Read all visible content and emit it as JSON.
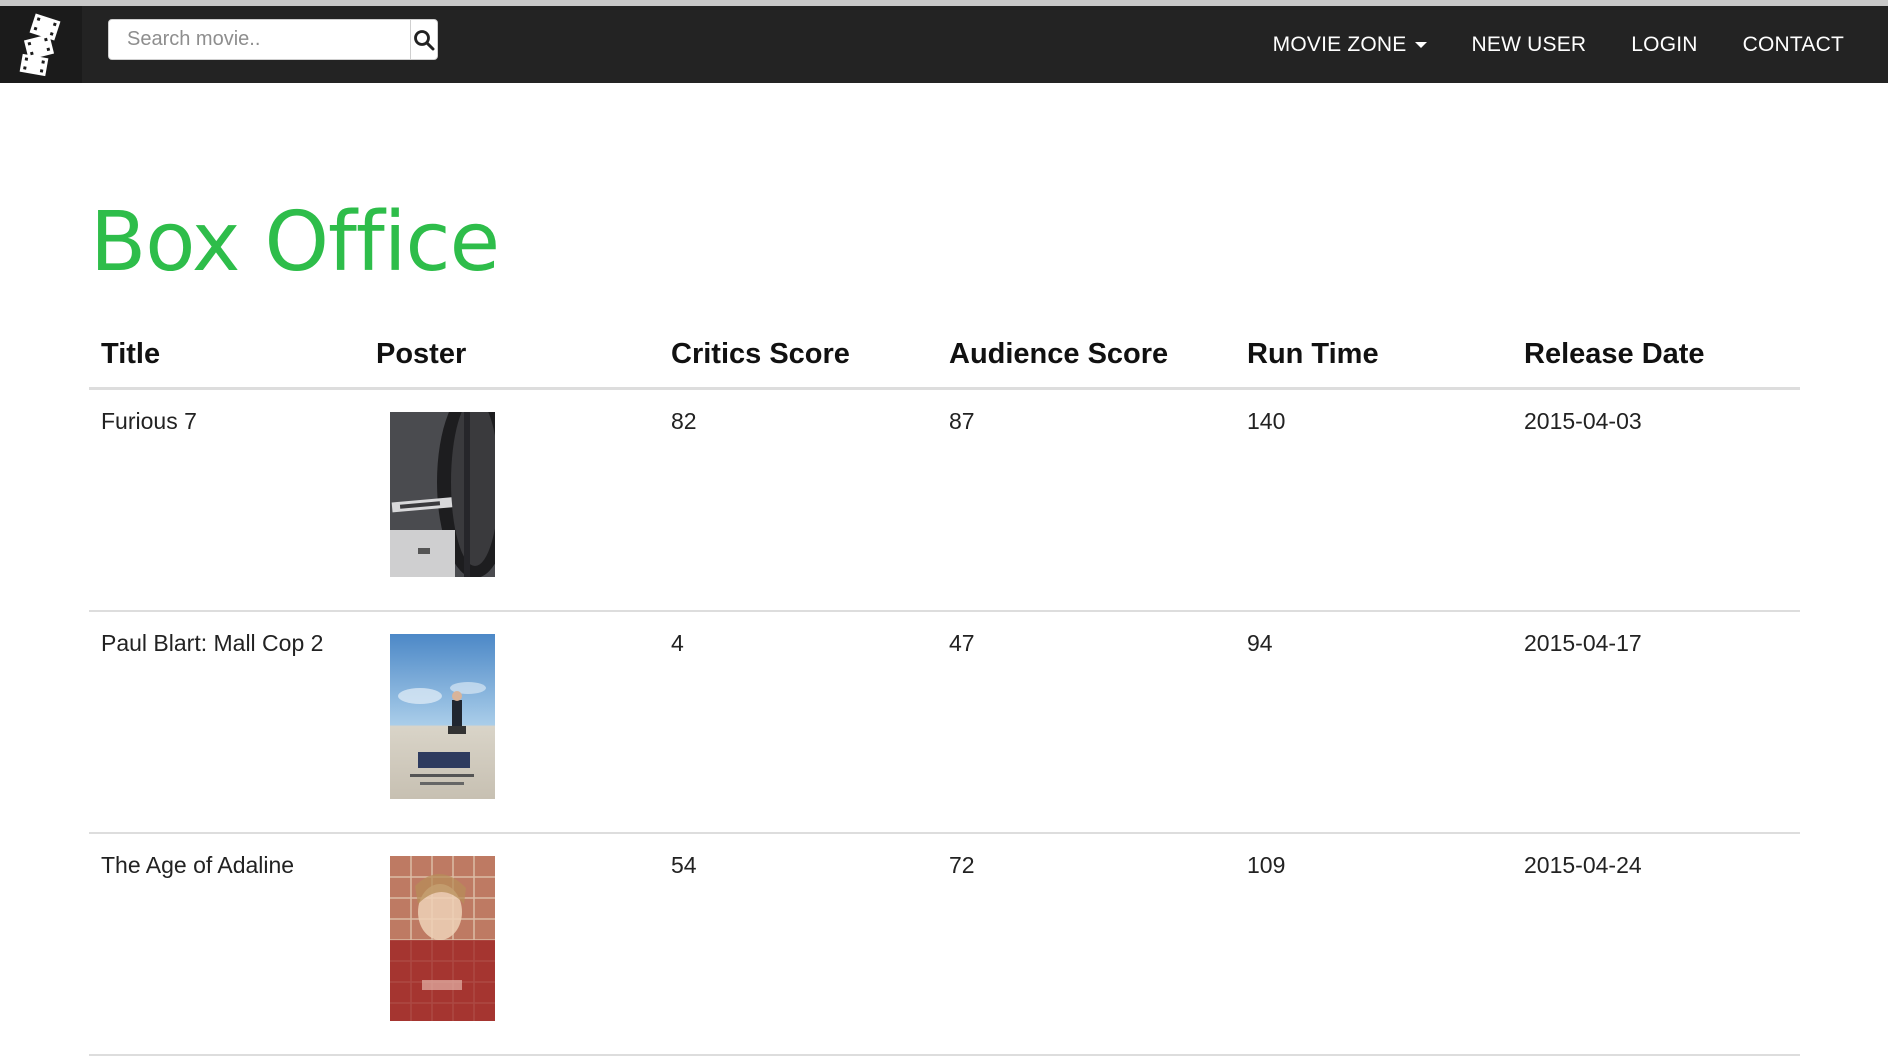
{
  "navbar": {
    "logo_icon": "film-reel-icon",
    "search": {
      "placeholder": "Search movie..",
      "value": "",
      "button_icon": "search-icon"
    },
    "links": {
      "movie_zone": "MOVIE ZONE",
      "new_user": "NEW USER",
      "login": "LOGIN",
      "contact": "CONTACT"
    }
  },
  "page": {
    "title": "Box Office"
  },
  "table": {
    "headers": [
      "Title",
      "Poster",
      "Critics Score",
      "Audience Score",
      "Run Time",
      "Release Date"
    ],
    "rows": [
      {
        "title": "Furious 7",
        "poster": "furious-7-poster",
        "critics_score": "82",
        "audience_score": "87",
        "run_time": "140",
        "release_date": "2015-04-03"
      },
      {
        "title": "Paul Blart: Mall Cop 2",
        "poster": "paul-blart-mall-cop-2-poster",
        "critics_score": "4",
        "audience_score": "47",
        "run_time": "94",
        "release_date": "2015-04-17"
      },
      {
        "title": "The Age of Adaline",
        "poster": "the-age-of-adaline-poster",
        "critics_score": "54",
        "audience_score": "72",
        "run_time": "109",
        "release_date": "2015-04-24"
      }
    ]
  },
  "colors": {
    "navbar_bg": "#232323",
    "title_green": "#2ebd4a",
    "row_border": "#dddddd"
  }
}
